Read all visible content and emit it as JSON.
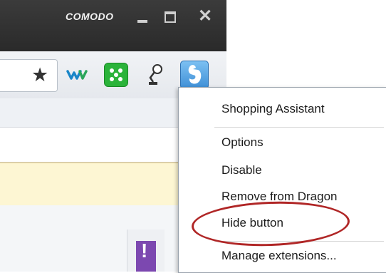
{
  "titlebar": {
    "brand": "COMODO",
    "controls": [
      "minimize-icon",
      "maximize-icon",
      "close-icon"
    ],
    "close_glyph": "✕",
    "background": "#2f2f2f"
  },
  "toolbar": {
    "icons": [
      "star-icon",
      "wiki-w-icon",
      "green-dice-extension-icon",
      "lamp-extension-icon",
      "shopping-assistant-dragon-icon"
    ],
    "star_glyph": "★"
  },
  "context_menu": {
    "items": [
      "Shopping Assistant",
      "Options",
      "Disable",
      "Remove from Dragon",
      "Hide button",
      "Manage extensions..."
    ],
    "highlighted_item": "Hide button",
    "highlight_color": "#b02626"
  }
}
